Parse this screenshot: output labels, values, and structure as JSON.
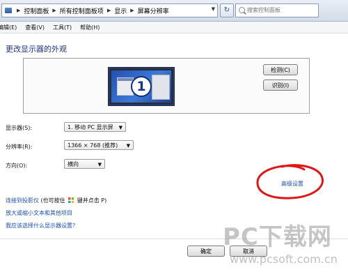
{
  "address_bar": {
    "breadcrumbs": [
      "控制面板",
      "所有控制面板项",
      "显示",
      "屏幕分辨率"
    ],
    "refresh_glyph": "↻",
    "search_placeholder": "搜索控制面板"
  },
  "menubar": {
    "items": [
      "编辑(E)",
      "查看(V)",
      "工具(T)",
      "帮助(H)"
    ]
  },
  "main": {
    "title": "更改显示器的外观",
    "monitor_number": "1",
    "detect_button": "检测(C)",
    "identify_button": "识别(I)",
    "display_label": "显示器(S):",
    "display_value": "1. 移动 PC 显示屏",
    "resolution_label": "分辨率(R):",
    "resolution_value": "1366 × 768 (推荐)",
    "orientation_label": "方向(O):",
    "orientation_value": "横向",
    "advanced_link": "高级设置",
    "projector_link": "连接到投影仪",
    "projector_hint_pre": "(也可按住",
    "projector_hint_post": "键并点击 P)",
    "text_size_link": "放大或缩小文本和其他项目",
    "which_settings_link": "我应该选择什么显示器设置?"
  },
  "footer": {
    "ok_button": "确定",
    "cancel_button": "取消"
  },
  "watermark": {
    "main_text": "PC下载网",
    "url_text": "www.pcsoft.com.cn"
  },
  "colors": {
    "annotation_circle": "#e01515",
    "link": "#1a4fb4",
    "title": "#1e3287"
  },
  "icons": {
    "back": "back-arrow-icon",
    "breadcrumb_root": "control-panel-icon",
    "search": "search-icon",
    "refresh": "refresh-icon",
    "windows_key": "windows-logo-icon"
  }
}
